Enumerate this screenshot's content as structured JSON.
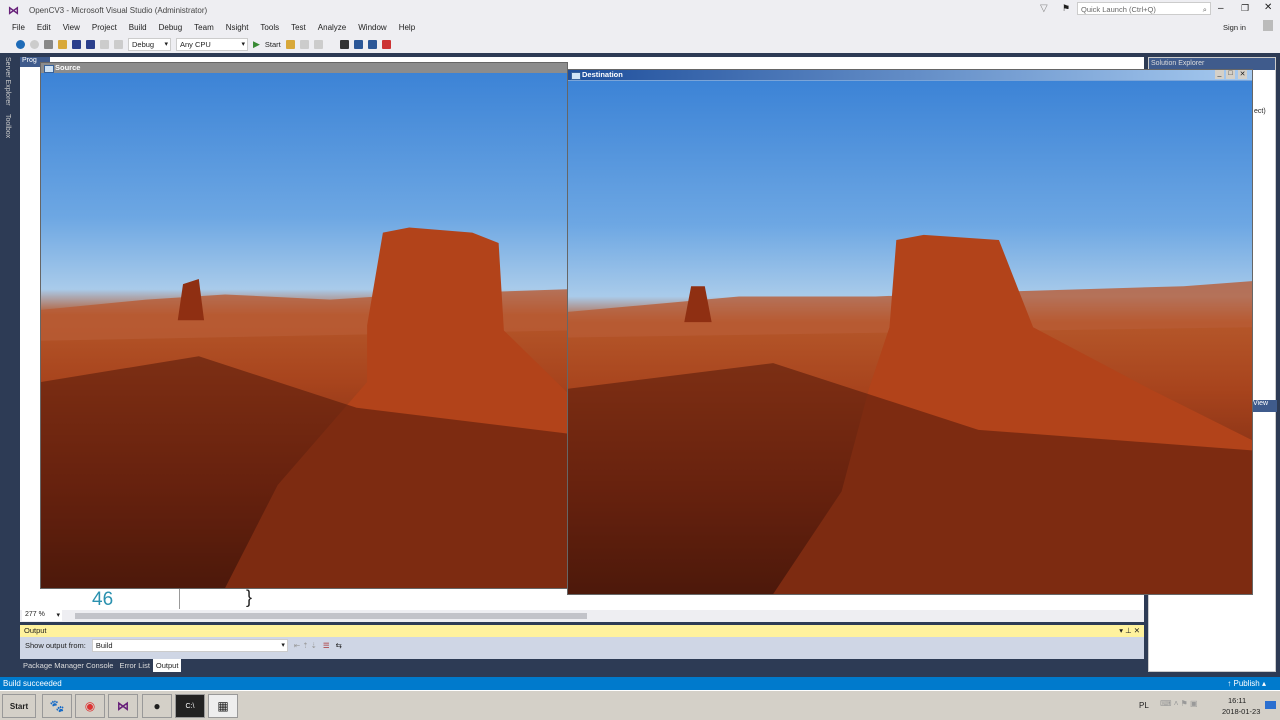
{
  "window": {
    "title": "OpenCV3 - Microsoft Visual Studio (Administrator)",
    "quick_launch_placeholder": "Quick Launch (Ctrl+Q)",
    "sign_in": "Sign in"
  },
  "menu": [
    "File",
    "Edit",
    "View",
    "Project",
    "Build",
    "Debug",
    "Team",
    "Nsight",
    "Tools",
    "Test",
    "Analyze",
    "Window",
    "Help"
  ],
  "toolbar": {
    "config": "Debug",
    "platform": "Any CPU",
    "start": "Start"
  },
  "side_tabs": [
    "Server Explorer",
    "Toolbox"
  ],
  "editor": {
    "tab_partial": "Prog",
    "line_number": "46",
    "code": "}",
    "zoom": "277 %"
  },
  "source_window": {
    "title": "Source"
  },
  "destination_window": {
    "title": "Destination"
  },
  "solution_explorer": {
    "title": "Solution Explorer",
    "partial_text": "ect)",
    "view_partial": "View"
  },
  "output": {
    "title": "Output",
    "show_from_label": "Show output from:",
    "show_from_value": "Build",
    "tabs": [
      "Package Manager Console",
      "Error List",
      "Output"
    ]
  },
  "status": {
    "text": "Build succeeded",
    "publish": "Publish"
  },
  "taskbar": {
    "start": "Start",
    "lang": "PL",
    "time": "16:11",
    "date": "2018-01-23"
  }
}
